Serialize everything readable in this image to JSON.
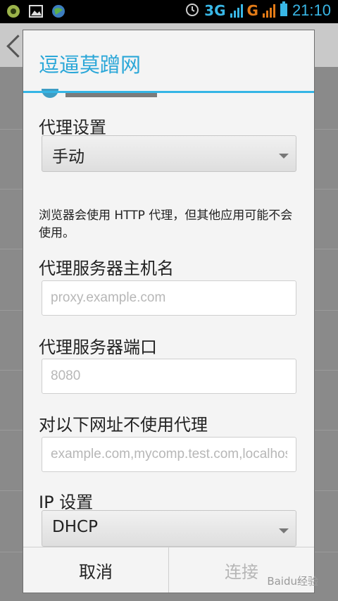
{
  "status_bar": {
    "network_3g": "3G",
    "network_g": "G",
    "time": "21:10",
    "icons": [
      "app-icon",
      "gallery-icon",
      "browser-icon",
      "alarm-icon",
      "signal-3g-icon",
      "signal-g-icon",
      "battery-icon"
    ]
  },
  "dialog": {
    "title": "逗逼莫蹭网",
    "proxy_label": "代理设置",
    "proxy_value": "手动",
    "note": "浏览器会使用 HTTP 代理，但其他应用可能不会使用。",
    "host_label": "代理服务器主机名",
    "host_placeholder": "proxy.example.com",
    "port_label": "代理服务器端口",
    "port_placeholder": "8080",
    "bypass_label": "对以下网址不使用代理",
    "bypass_placeholder": "example.com,mycomp.test.com,localhost",
    "ip_label": "IP 设置",
    "ip_value": "DHCP",
    "cancel_label": "取消",
    "connect_label": "连接"
  },
  "colors": {
    "accent": "#34b5e5",
    "title": "#2ba7d8",
    "disabled_text": "#b6b6b6"
  },
  "watermark": "Baidu经验"
}
